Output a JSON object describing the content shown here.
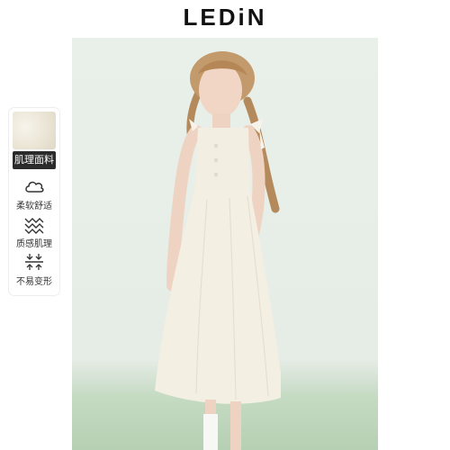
{
  "brand": {
    "name": "LEDiN"
  },
  "sidebar": {
    "fabric_label": "肌理面料",
    "features": [
      {
        "icon": "cloud-icon",
        "label": "柔软舒适"
      },
      {
        "icon": "zigzag-texture-icon",
        "label": "质感肌理"
      },
      {
        "icon": "stretch-arrows-icon",
        "label": "不易变形"
      }
    ]
  },
  "colors": {
    "background": "#e8eee8",
    "floor": "#b9d2b6",
    "dress": "#f3eee2",
    "badge": "#2b2b2b"
  }
}
